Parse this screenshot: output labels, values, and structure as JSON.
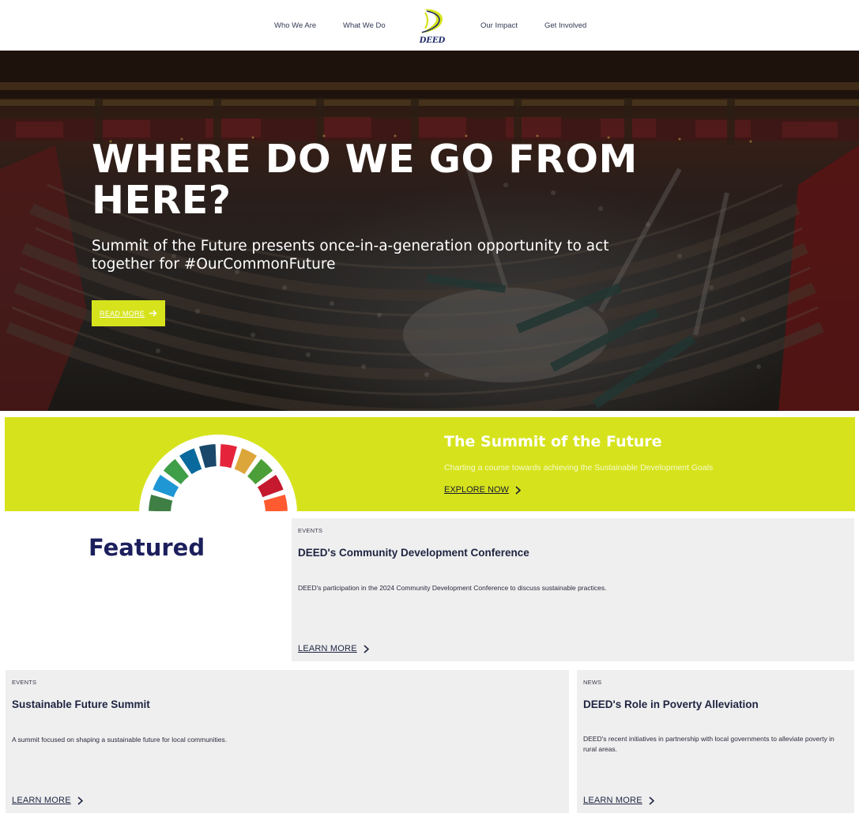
{
  "nav": {
    "links": [
      "Who We Are",
      "What We Do",
      "Our Impact",
      "Get Involved"
    ],
    "logo_text": "DEED"
  },
  "hero": {
    "title": "WHERE DO WE GO FROM HERE?",
    "subtitle": "Summit of the Future presents once-in-a-generation opportunity to act together for #OurCommonFuture",
    "button_label": "READ MORE",
    "button_icon": "arrow-right-icon"
  },
  "banner": {
    "title": "The Summit of the Future",
    "description": "Charting a course towards achieving the Sustainable Development Goals",
    "cta_label": "EXPLORE NOW",
    "cta_icon": "chevron-right-icon",
    "background_color": "#d6e31c"
  },
  "featured": {
    "heading": "Featured",
    "cards": [
      {
        "category": "EVENTS",
        "title": "DEED's Community Development Conference",
        "description": "DEED's participation in the 2024 Community Development Conference to discuss sustainable practices.",
        "cta_label": "LEARN MORE"
      },
      {
        "category": "EVENTS",
        "title": "Sustainable Future Summit",
        "description": "A summit focused on shaping a sustainable future for local communities.",
        "cta_label": "LEARN MORE"
      },
      {
        "category": "NEWS",
        "title": "DEED's Role in Poverty Alleviation",
        "description": "DEED's recent initiatives in partnership with local governments to alleviate poverty in rural areas.",
        "cta_label": "LEARN MORE"
      }
    ]
  },
  "colors": {
    "accent": "#d6e31c",
    "navy": "#1c1f5c",
    "card_bg": "#efeff0"
  }
}
